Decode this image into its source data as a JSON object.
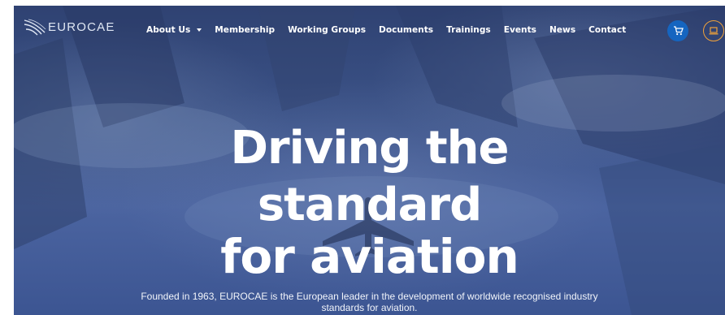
{
  "brand": {
    "logo_text": "EUROCAE"
  },
  "nav": {
    "items": [
      {
        "label": "About Us",
        "has_dropdown": true
      },
      {
        "label": "Membership",
        "has_dropdown": false
      },
      {
        "label": "Working Groups",
        "has_dropdown": false
      },
      {
        "label": "Documents",
        "has_dropdown": false
      },
      {
        "label": "Trainings",
        "has_dropdown": false
      },
      {
        "label": "Events",
        "has_dropdown": false
      },
      {
        "label": "News",
        "has_dropdown": false
      },
      {
        "label": "Contact",
        "has_dropdown": false
      }
    ],
    "cart_icon": "shopping-cart-icon",
    "login_icon": "laptop-icon"
  },
  "hero": {
    "headline_lines": [
      "Driving the",
      "standard",
      "for aviation"
    ],
    "intro": "Founded in 1963, EUROCAE is the European leader in the development of worldwide recognised industry standards for aviation."
  },
  "colors": {
    "hero_bg": "#3b5287",
    "cart_button": "#1565c0",
    "login_ring": "#f0a23a",
    "text": "#ffffff"
  }
}
